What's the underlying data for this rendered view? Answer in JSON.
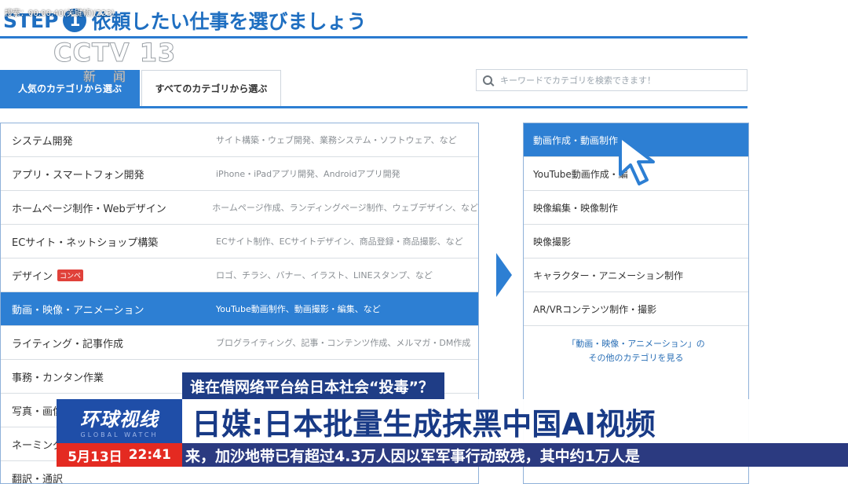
{
  "page": {
    "step_label": "STEP",
    "step_number": "1",
    "heading": "依頼したい仕事を選びましょう",
    "tabs": [
      {
        "label": "人気のカテゴリから選ぶ",
        "active": true
      },
      {
        "label": "すべてのカテゴリから選ぶ",
        "active": false
      }
    ],
    "search": {
      "placeholder": "キーワードでカテゴリを検索できます！",
      "icon": "search-icon"
    },
    "categories": [
      {
        "name": "システム開発",
        "desc": "サイト構築・ウェブ開発、業務システム・ソフトウェア、など"
      },
      {
        "name": "アプリ・スマートフォン開発",
        "desc": "iPhone・iPadアプリ開発、Androidアプリ開発"
      },
      {
        "name": "ホームページ制作・Webデザイン",
        "desc": "ホームページ作成、ランディングページ制作、ウェブデザイン、など"
      },
      {
        "name": "ECサイト・ネットショップ構築",
        "desc": "ECサイト制作、ECサイトデザイン、商品登録・商品撮影、など"
      },
      {
        "name": "デザイン",
        "badge": "コンペ",
        "desc": "ロゴ、チラシ、バナー、イラスト、LINEスタンプ、など"
      },
      {
        "name": "動画・映像・アニメーション",
        "desc": "YouTube動画制作、動画撮影・編集、など",
        "selected": true
      },
      {
        "name": "ライティング・記事作成",
        "desc": "ブログライティング、記事・コンテンツ作成、メルマガ・DM作成"
      },
      {
        "name": "事務・カンタン作業",
        "desc": ""
      },
      {
        "name": "写真・画像",
        "desc": ""
      },
      {
        "name": "ネーミング",
        "desc": ""
      },
      {
        "name": "翻訳・通訳",
        "desc": ""
      }
    ],
    "subcategories": [
      {
        "label": "動画作成・動画制作",
        "header": true
      },
      {
        "label": "YouTube動画作成・編"
      },
      {
        "label": "映像編集・映像制作"
      },
      {
        "label": "映像撮影"
      },
      {
        "label": "キャラクター・アニメーション制作"
      },
      {
        "label": "AR/VRコンテンツ制作・撮影"
      }
    ],
    "subcategory_more": {
      "line1": "「動画・映像・アニメーション」の",
      "line2": "その他のカテゴリを見る"
    }
  },
  "broadcast": {
    "timecode": "搜索：00:00:40(关键帧)(223)",
    "channel_logo": "CCTV 13",
    "channel_sub": "新闻",
    "program_name": "环球视线",
    "program_english": "GLOBAL WATCH",
    "headline_top": "谁在借网络平台给日本社会“投毒”？",
    "headline_main": "日媒:日本批量生成抹黑中国AI视频",
    "date": "5月13日",
    "time": "22:41",
    "ticker": "来，加沙地带已有超过4.3万人因以军军事行动致残，其中约1万人是"
  },
  "colors": {
    "accent_blue": "#2d7fd3",
    "headline_navy": "#1f3d86",
    "date_red": "#e42a21",
    "badge_red": "#e0413a"
  }
}
